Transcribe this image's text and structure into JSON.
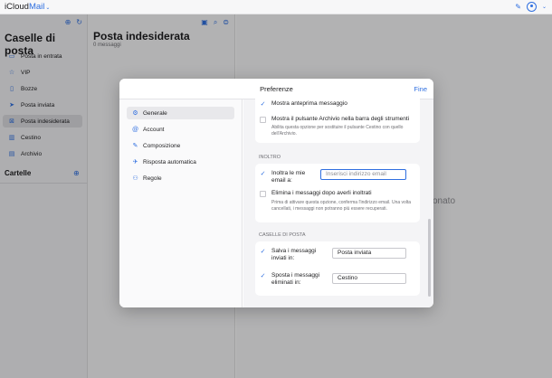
{
  "app": {
    "brand_a": "iCloud",
    "brand_b": "Mail"
  },
  "sidebar": {
    "title": "Caselle di posta",
    "items": [
      {
        "label": "Posta in entrata",
        "icon": "tray-icon"
      },
      {
        "label": "VIP",
        "icon": "star-icon"
      },
      {
        "label": "Bozze",
        "icon": "document-icon"
      },
      {
        "label": "Posta inviata",
        "icon": "paper-plane-icon"
      },
      {
        "label": "Posta indesiderata",
        "icon": "junk-icon",
        "active": true
      },
      {
        "label": "Cestino",
        "icon": "trash-icon"
      },
      {
        "label": "Archivio",
        "icon": "archive-icon"
      }
    ],
    "folders_label": "Cartelle"
  },
  "message_list": {
    "title": "Posta indesiderata",
    "count": "0 messaggi"
  },
  "reading": {
    "partial_text": "onato"
  },
  "modal": {
    "title": "Preferenze",
    "done_label": "Fine",
    "nav": [
      {
        "label": "Generale",
        "icon": "gear-icon",
        "active": true
      },
      {
        "label": "Account",
        "icon": "at-sign-icon"
      },
      {
        "label": "Composizione",
        "icon": "compose-icon"
      },
      {
        "label": "Risposta automatica",
        "icon": "auto-reply-icon"
      },
      {
        "label": "Regole",
        "icon": "rules-icon"
      }
    ],
    "general": {
      "show_preview": "Mostra anteprima messaggio",
      "show_archive": "Mostra il pulsante Archivio nella barra degli strumenti",
      "show_archive_help": "Abilita questa opzione per sostituire il pulsante Cestino con quello dell'Archivio."
    },
    "forwarding": {
      "title": "INOLTRO",
      "forward_label": "Inoltra le mie email a:",
      "forward_placeholder": "Inserisci indirizzo email",
      "delete_label": "Elimina i messaggi dopo averli inoltrati",
      "delete_help": "Prima di attivare questa opzione, conferma l'indirizzo email. Una volta cancellati, i messaggi non potranno più essere recuperati."
    },
    "mailboxes": {
      "title": "CASELLE DI POSTA",
      "save_label": "Salva i messaggi inviati in:",
      "save_value": "Posta inviata",
      "move_label": "Sposta i messaggi eliminati in:",
      "move_value": "Cestino"
    }
  },
  "colors": {
    "accent": "#2f6fe0"
  }
}
